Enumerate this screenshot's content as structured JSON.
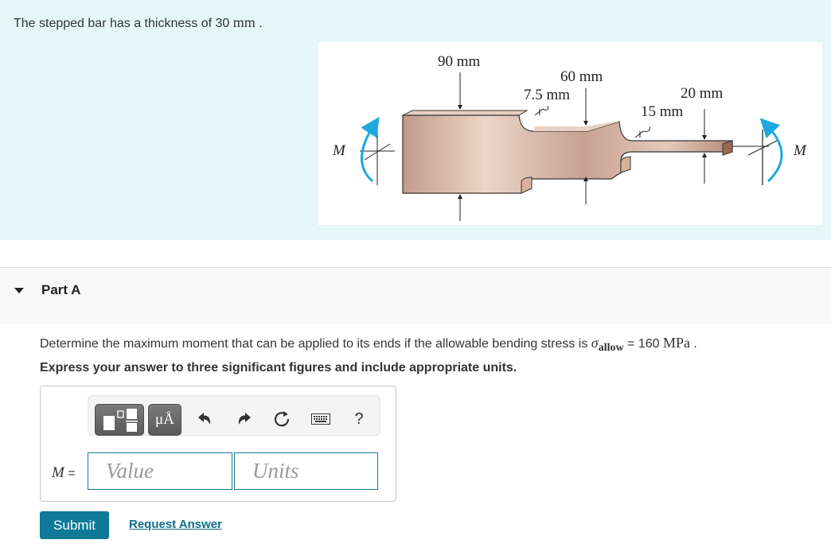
{
  "intro": {
    "text_prefix": "The stepped bar has a thickness of 30 ",
    "unit": "mm",
    "suffix": "."
  },
  "figure": {
    "labels": {
      "dim_90": "90 mm",
      "dim_60": "60 mm",
      "dim_7_5": "7.5 mm",
      "dim_20": "20 mm",
      "dim_15": "15 mm",
      "moment_left": "M",
      "moment_right": "M"
    },
    "colors": {
      "bar": "#c9a595",
      "moment_arrow": "#1ea8e0"
    }
  },
  "part": {
    "title": "Part A",
    "question_prefix": "Determine the maximum moment that can be applied to its ends if the allowable bending stress is ",
    "sigma": "σ",
    "sigma_sub": "allow",
    "question_eq": " = 160 ",
    "question_unit": "MPa",
    "question_suffix": " .",
    "instruction": "Express your answer to three significant figures and include appropriate units."
  },
  "toolbar": {
    "units_label": "μÅ",
    "help_label": "?"
  },
  "answer": {
    "variable": "M",
    "equals": " =",
    "value_placeholder": "Value",
    "units_placeholder": "Units"
  },
  "actions": {
    "submit_label": "Submit",
    "request_label": "Request Answer"
  },
  "colors": {
    "accent": "#0e7a98",
    "intro_bg": "#e6f6f7",
    "link": "#0e6e8c"
  }
}
